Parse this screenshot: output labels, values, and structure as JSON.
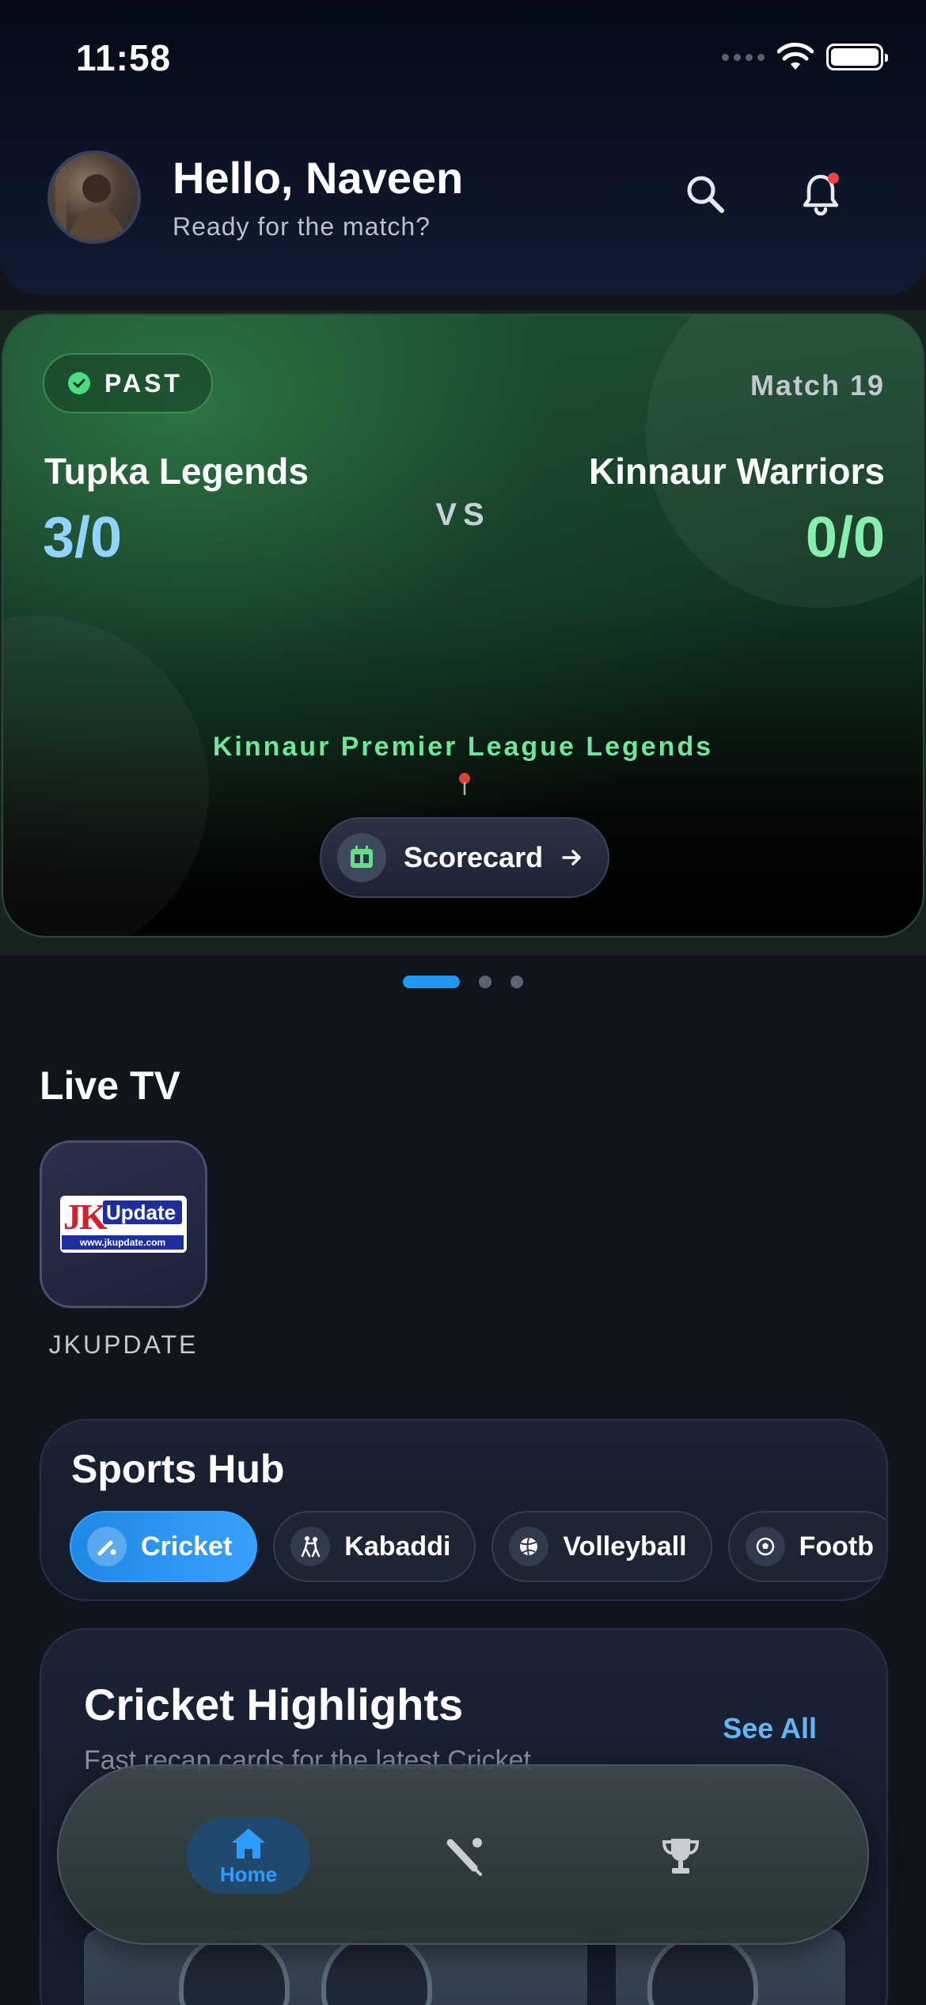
{
  "status_bar": {
    "time": "11:58"
  },
  "header": {
    "greeting": "Hello, Naveen",
    "subtitle": "Ready for the match?",
    "search_icon": "search-icon",
    "notification_icon": "bell-icon"
  },
  "match": {
    "status": "PAST",
    "match_number": "Match 19",
    "team_home": "Tupka Legends",
    "score_home": "3/0",
    "vs": "VS",
    "team_away": "Kinnaur Warriors",
    "score_away": "0/0",
    "league": "Kinnaur Premier League Legends",
    "scorecard_label": "Scorecard",
    "colors": {
      "home_score": "#8fd3ff",
      "away_score": "#86efac",
      "league": "#6ee79a"
    }
  },
  "carousel": {
    "pages": 3,
    "active_index": 0
  },
  "live_tv": {
    "title": "Live TV",
    "channels": [
      {
        "name": "JKUPDATE",
        "logo_text": "JK",
        "logo_word": "Update",
        "logo_url": "www.jkupdate.com"
      }
    ]
  },
  "sports_hub": {
    "title": "Sports Hub",
    "chips": [
      {
        "label": "Cricket",
        "icon": "cricket-icon",
        "active": true
      },
      {
        "label": "Kabaddi",
        "icon": "kabaddi-icon",
        "active": false
      },
      {
        "label": "Volleyball",
        "icon": "volleyball-icon",
        "active": false
      },
      {
        "label": "Footb",
        "icon": "football-icon",
        "active": false
      }
    ]
  },
  "highlights": {
    "title": "Cricket Highlights",
    "see_all": "See All",
    "subtitle": "Fast recap cards for the latest Cricket"
  },
  "bottom_nav": {
    "items": [
      {
        "label": "Home",
        "icon": "home-icon",
        "active": true
      },
      {
        "label": "",
        "icon": "cricket-bat-icon",
        "active": false
      },
      {
        "label": "",
        "icon": "trophy-icon",
        "active": false
      }
    ]
  },
  "accent": "#2196f3"
}
